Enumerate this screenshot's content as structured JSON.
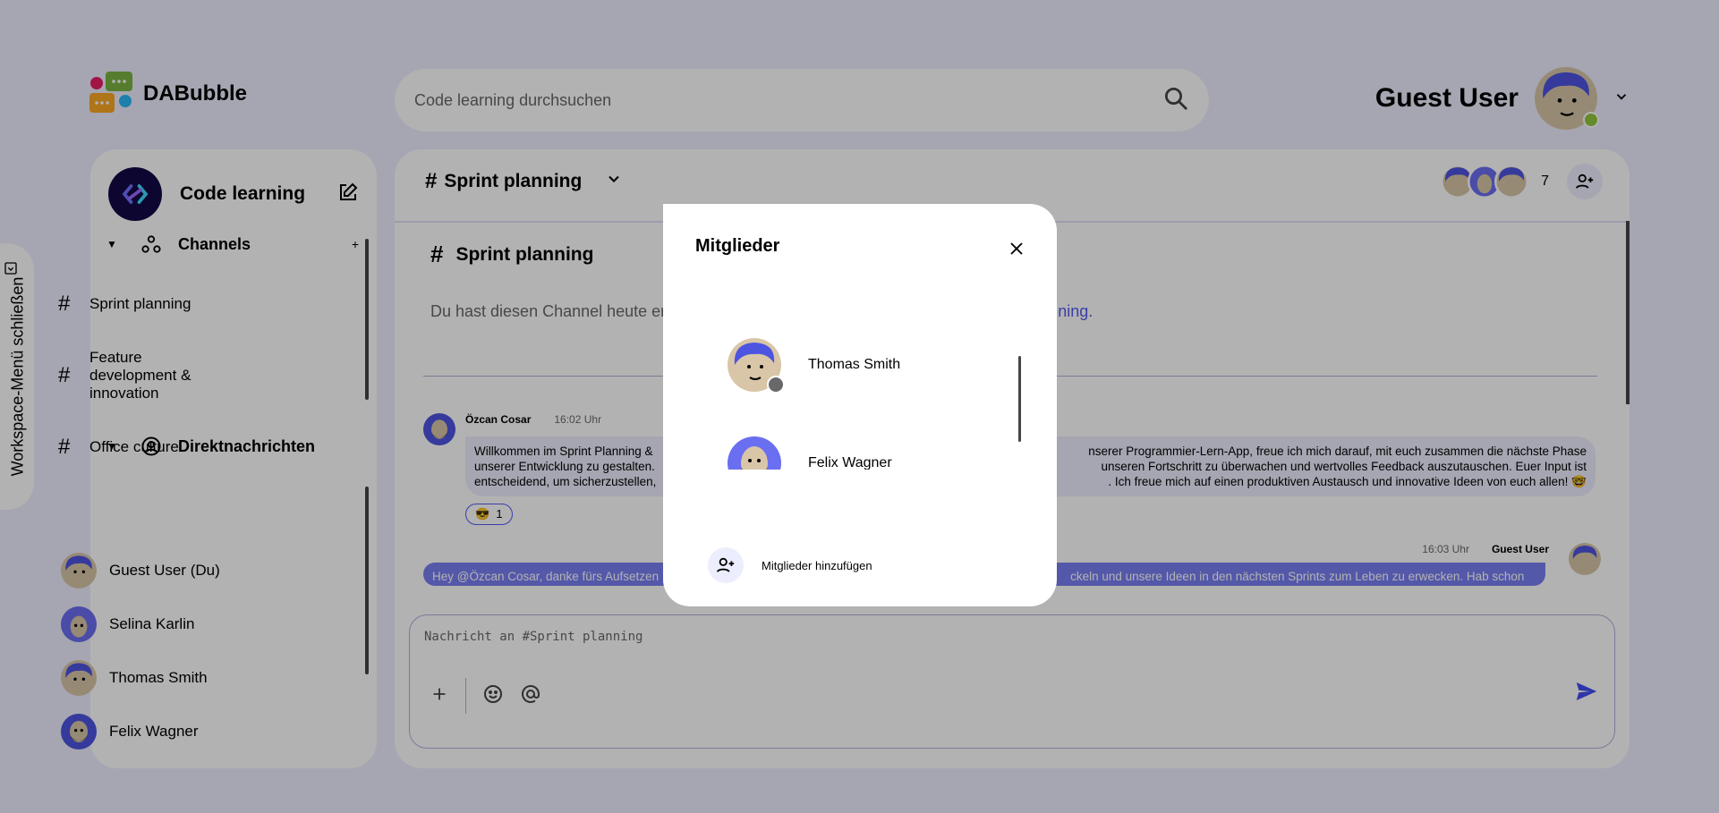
{
  "app": {
    "title": "DABubble"
  },
  "colors": {
    "accent": "#535af1",
    "background": "#eceefe",
    "online": "#92c83e",
    "away": "#686868"
  },
  "search": {
    "placeholder": "Code learning durchsuchen"
  },
  "user": {
    "name": "Guest User"
  },
  "workspace_toggle": {
    "label": "Workspace-Menü schließen"
  },
  "sidebar": {
    "workspace_title": "Code learning",
    "channels_label": "Channels",
    "channels_add": "+",
    "channels": [
      {
        "label": "Sprint planning"
      },
      {
        "label": "Feature development & innovation"
      },
      {
        "label": "Office culture"
      }
    ],
    "dm_label": "Direktnachrichten",
    "dms": [
      {
        "label": "Guest User (Du)"
      },
      {
        "label": "Selina Karlin"
      },
      {
        "label": "Thomas Smith"
      },
      {
        "label": "Felix Wagner"
      }
    ]
  },
  "channel": {
    "name": "Sprint planning",
    "member_count": "7",
    "intro_title": "Sprint planning",
    "intro_text": "Du hast diesen Channel heute er",
    "intro_link": "ning."
  },
  "messages": [
    {
      "author": "Özcan Cosar",
      "time": "16:02 Uhr",
      "text_line1": "Willkommen im Sprint Planning &",
      "text_line1_right": "nserer Programmier-Lern-App, freue ich mich darauf, mit euch zusammen die nächste Phase",
      "text_line2": "unserer Entwicklung zu gestalten.",
      "text_line2_right": "unseren Fortschritt zu überwachen und wertvolles Feedback auszutauschen. Euer Input ist",
      "text_line3": "entscheidend, um sicherzustellen,",
      "text_line3_right": ". Ich freue mich auf einen produktiven Austausch und innovative Ideen von euch allen! 🤓",
      "reaction_emoji": "😎",
      "reaction_count": "1"
    },
    {
      "author": "Guest User",
      "time": "16:03 Uhr",
      "text_left": "Hey @Özcan Cosar, danke fürs Aufsetzen",
      "text_right": "ckeln und unsere Ideen in den nächsten Sprints zum Leben zu erwecken. Hab schon"
    }
  ],
  "composer": {
    "placeholder": "Nachricht an #Sprint planning"
  },
  "modal": {
    "title": "Mitglieder",
    "members": [
      {
        "name": "Thomas Smith"
      },
      {
        "name": "Felix Wagner"
      },
      {
        "name": ""
      }
    ],
    "add_label": "Mitglieder hinzufügen"
  }
}
